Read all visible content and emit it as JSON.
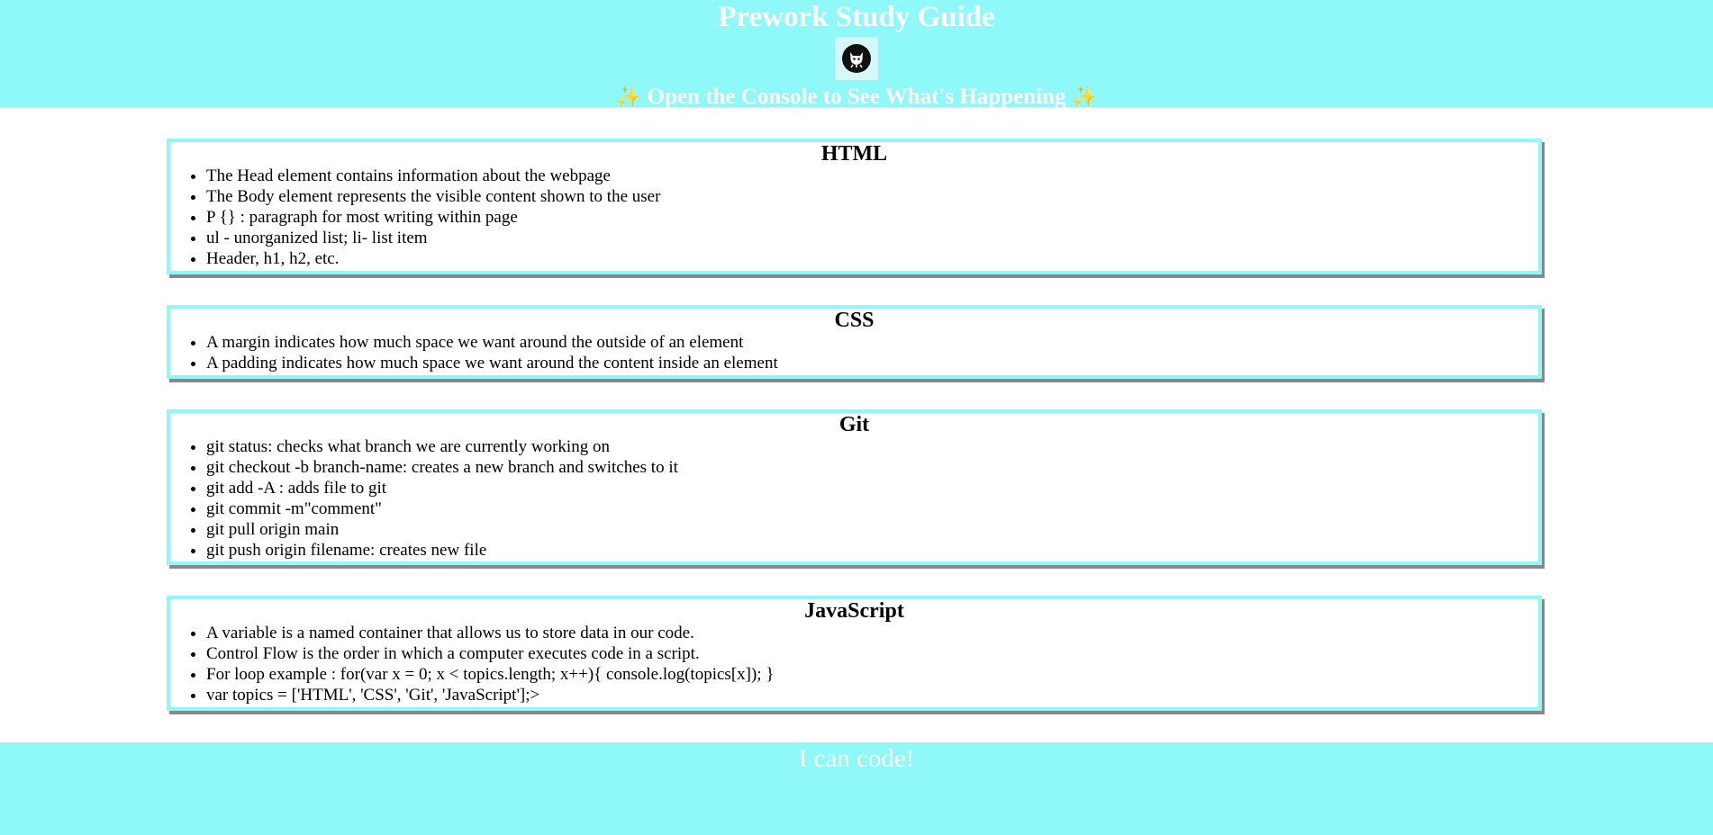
{
  "header": {
    "title": "Prework Study Guide",
    "subtitle_text": "Open the Console to See What's Happening",
    "sparkle_left": "✨",
    "sparkle_right": "✨",
    "avatar_icon": "github-octocat-icon"
  },
  "sections": [
    {
      "title": "HTML",
      "items": [
        "The Head element contains information about the webpage",
        "The Body element represents the visible content shown to the user",
        "P {} : paragraph for most writing within page",
        "ul - unorganized list; li- list item",
        "Header, h1, h2, etc."
      ]
    },
    {
      "title": "CSS",
      "items": [
        "A margin indicates how much space we want around the outside of an element",
        "A padding indicates how much space we want around the content inside an element"
      ]
    },
    {
      "title": "Git",
      "items": [
        "git status: checks what branch we are currently working on",
        "git checkout -b branch-name: creates a new branch and switches to it",
        "git add -A : adds file to git",
        "git commit -m\"comment\"",
        "git pull origin main",
        "git push origin filename: creates new file"
      ]
    },
    {
      "title": "JavaScript",
      "items": [
        "A variable is a named container that allows us to store data in our code.",
        "Control Flow is the order in which a computer executes code in a script.",
        "For loop example : for(var x = 0; x < topics.length; x++){ console.log(topics[x]); }",
        "var topics = ['HTML', 'CSS', 'Git', 'JavaScript'];>"
      ]
    }
  ],
  "footer": {
    "text": "I can code!"
  },
  "colors": {
    "accent": "#8ff8f8",
    "shadow": "#888888",
    "header_text": "#ffffff"
  }
}
